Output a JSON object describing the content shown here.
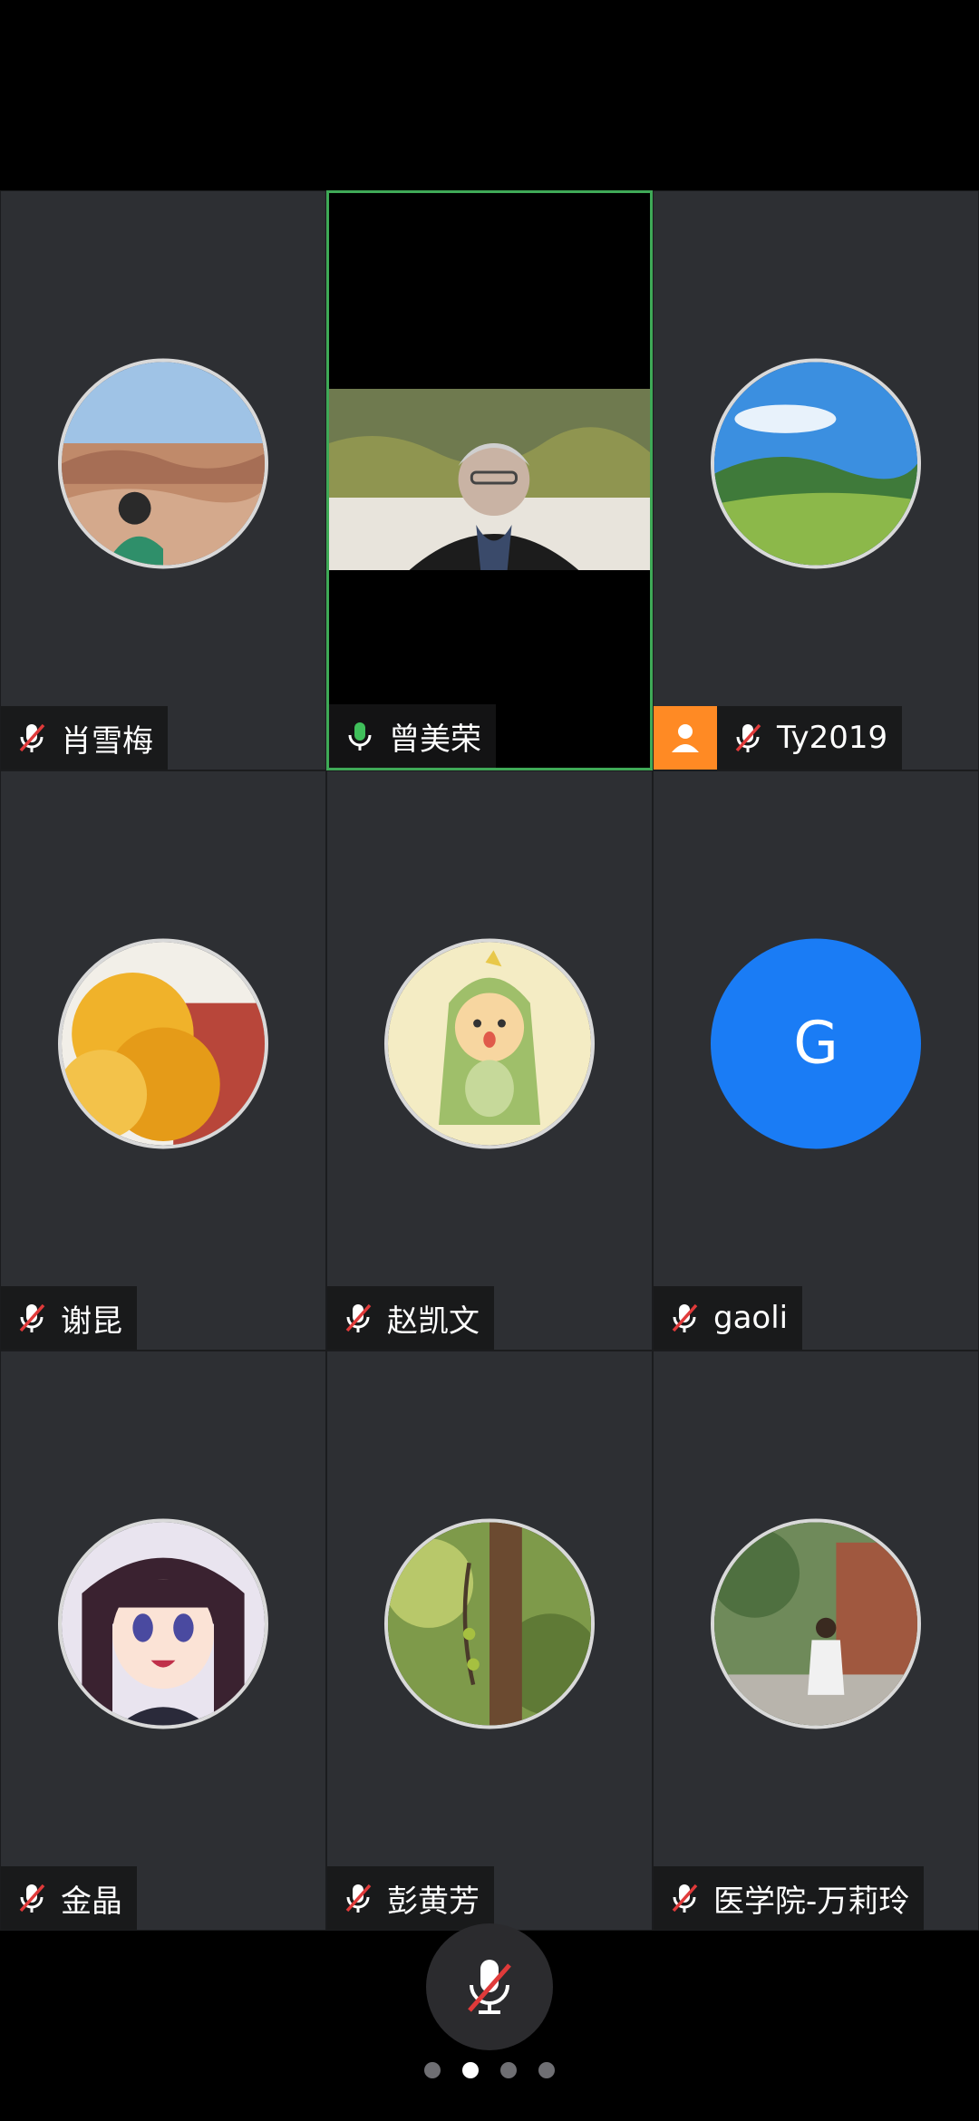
{
  "participants": [
    {
      "name": "肖雪梅",
      "mic": "muted",
      "avatar": "photo-desert-person-icon"
    },
    {
      "name": "曾美荣",
      "mic": "active",
      "video": "camera-feed-elderly-woman"
    },
    {
      "name": "Ty2019",
      "mic": "muted",
      "avatar": "photo-green-valley-icon",
      "host_badge": "person-icon"
    },
    {
      "name": "谢昆",
      "mic": "muted",
      "avatar": "photo-ginkgo-tree-icon"
    },
    {
      "name": "赵凯文",
      "mic": "muted",
      "avatar": "cartoon-dinosaur-icon"
    },
    {
      "name": "gaoli",
      "mic": "muted",
      "avatar_letter": "G"
    },
    {
      "name": "金晶",
      "mic": "muted",
      "avatar": "anime-girl-icon"
    },
    {
      "name": "彭黄芳",
      "mic": "muted",
      "avatar": "photo-tree-buds-icon"
    },
    {
      "name": "医学院-万莉玲",
      "mic": "muted",
      "avatar": "photo-street-woman-icon"
    }
  ],
  "controls": {
    "mute_button": "muted-microphone-icon"
  },
  "pagination": {
    "total": 4,
    "current": 2
  },
  "colors": {
    "tile_bg": "#2d2f33",
    "active_border": "#3fa957",
    "host_badge": "#ff8a24",
    "letter_avatar": "#1a7cf5",
    "mic_muted": "#e03a3a",
    "mic_active": "#3fbf5a"
  }
}
